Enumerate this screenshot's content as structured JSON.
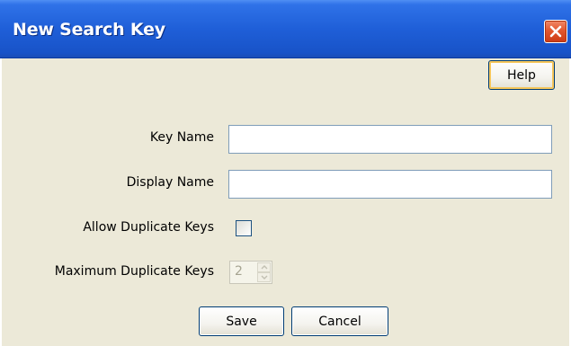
{
  "window": {
    "title": "New Search Key"
  },
  "toolbar": {
    "help_label": "Help"
  },
  "form": {
    "key_name": {
      "label": "Key Name",
      "value": ""
    },
    "display_name": {
      "label": "Display Name",
      "value": ""
    },
    "allow_duplicate_keys": {
      "label": "Allow Duplicate Keys",
      "checked": false
    },
    "maximum_duplicate_keys": {
      "label": "Maximum Duplicate Keys",
      "value": "2",
      "enabled": false
    }
  },
  "actions": {
    "save_label": "Save",
    "cancel_label": "Cancel"
  },
  "icons": {
    "close": "close-icon",
    "spinner_up": "chevron-up-icon",
    "spinner_down": "chevron-down-icon"
  },
  "colors": {
    "titlebar": "#1f5fd8",
    "dialog_background": "#ece9d8",
    "close_button": "#e2572e",
    "default_button_focus": "#f6c65b"
  }
}
